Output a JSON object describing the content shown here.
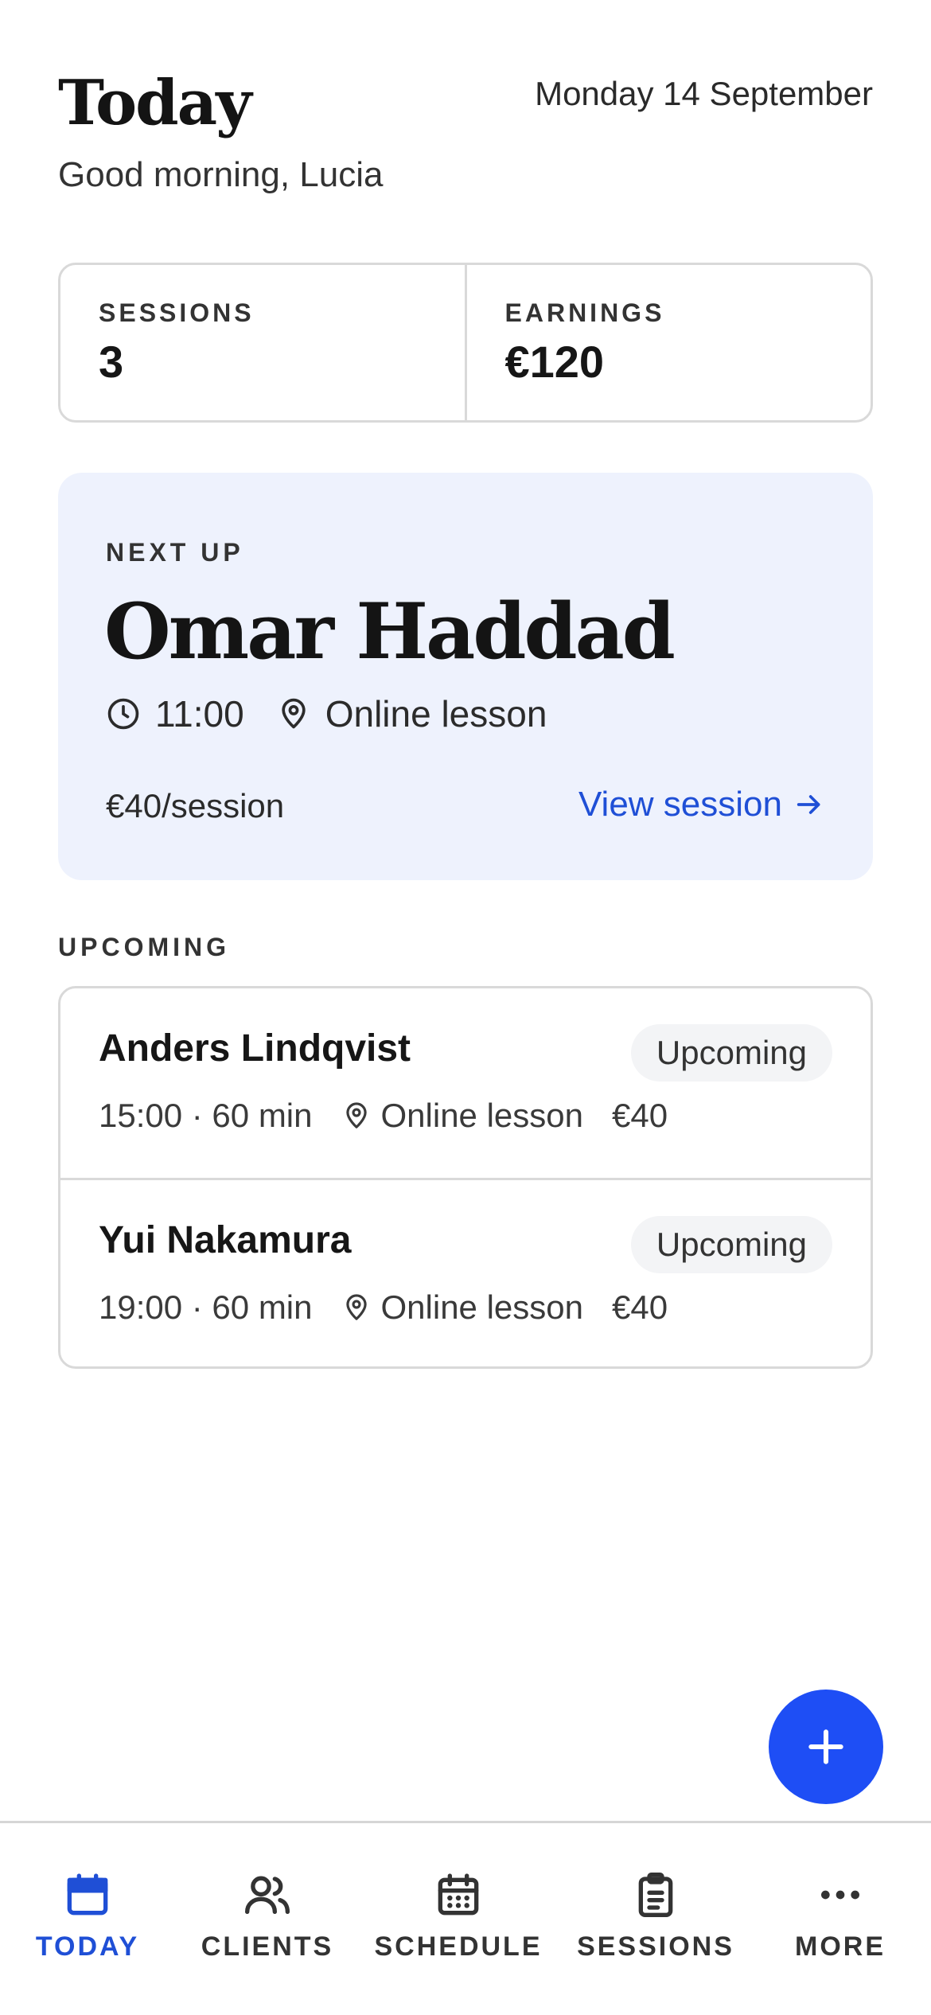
{
  "header": {
    "title": "Today",
    "date": "Monday 14 September",
    "greeting": "Good morning, Lucia"
  },
  "stats": [
    {
      "label": "SESSIONS",
      "value": "3"
    },
    {
      "label": "EARNINGS",
      "value": "€120"
    }
  ],
  "next_up": {
    "label": "NEXT UP",
    "name": "Omar Haddad",
    "time": "11:00",
    "location": "Online lesson",
    "price": "€40/session",
    "link": "View session"
  },
  "upcoming": {
    "label": "UPCOMING",
    "items": [
      {
        "name": "Anders Lindqvist",
        "status": "Upcoming",
        "time": "15:00 · 60 min",
        "location": "Online lesson",
        "price": "€40"
      },
      {
        "name": "Yui Nakamura",
        "status": "Upcoming",
        "time": "19:00 · 60 min",
        "location": "Online lesson",
        "price": "€40"
      }
    ]
  },
  "fab": {
    "icon": "plus-icon"
  },
  "nav": [
    {
      "label": "TODAY",
      "icon": "calendar-icon",
      "active": true
    },
    {
      "label": "CLIENTS",
      "icon": "users-icon",
      "active": false
    },
    {
      "label": "SCHEDULE",
      "icon": "calendar-grid-icon",
      "active": false
    },
    {
      "label": "SESSIONS",
      "icon": "clipboard-icon",
      "active": false
    },
    {
      "label": "MORE",
      "icon": "more-icon",
      "active": false
    }
  ],
  "colors": {
    "accent": "#1e4ef5",
    "link": "#1f4fd6",
    "card_bg": "#eef2fd"
  }
}
